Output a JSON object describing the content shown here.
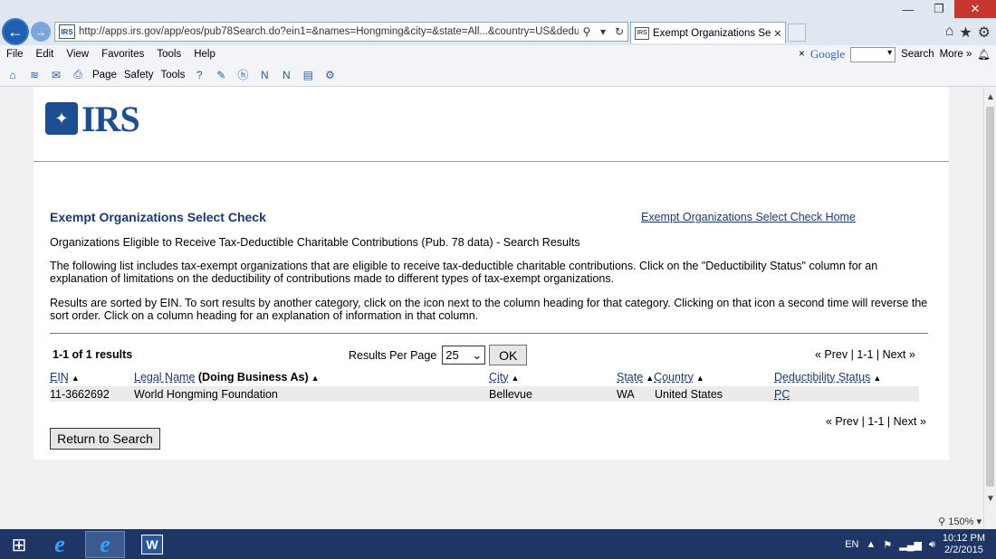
{
  "browser": {
    "url": "http://apps.irs.gov/app/eos/pub78Search.do?ein1=&names=Hongming&city=&state=All...&country=US&deductibility=al",
    "tab_title": "Exempt Organizations Sele...",
    "menu": [
      "File",
      "Edit",
      "View",
      "Favorites",
      "Tools",
      "Help"
    ],
    "commands": {
      "page": "Page",
      "safety": "Safety",
      "tools": "Tools"
    },
    "google_bar": {
      "close": "×",
      "logo": "Google",
      "search": "Search",
      "more": "More »"
    },
    "zoom": "150%",
    "icons": [
      "back-icon",
      "forward-icon",
      "home-icon",
      "star-icon",
      "gear-icon",
      "search-icon",
      "refresh-icon"
    ]
  },
  "page": {
    "logo_text": "IRS",
    "heading": "Exempt Organizations Select Check",
    "home_link": "Exempt Organizations Select Check Home",
    "subtitle": "Organizations Eligible to Receive Tax-Deductible Charitable Contributions (Pub. 78 data) - Search Results",
    "paragraph1": "The following list includes tax-exempt organizations that are eligible to receive tax-deductible charitable contributions. Click on the \"Deductibility Status\" column for an explanation of limitations on the deductibility of contributions made to different types of tax-exempt organizations.",
    "paragraph2": "Results are sorted by EIN. To sort results by another category, click on the icon next to the column heading for that category. Clicking on that icon a second time will reverse the sort order. Click on a column heading for an explanation of information in that column.",
    "results_count": "1-1 of 1 results",
    "results_per_page_label": "Results Per Page",
    "results_per_page_value": "25",
    "ok_label": "OK",
    "pager": {
      "prev": "« Prev",
      "range": "1-1",
      "next": "Next »",
      "sep": "|"
    },
    "columns": {
      "ein": "EIN",
      "legal_name": "Legal Name",
      "dba": "(Doing Business As)",
      "city": "City",
      "state": "State",
      "country": "Country",
      "deductibility": "Deductibility Status"
    },
    "rows": [
      {
        "ein": "11-3662692",
        "legal_name": "World Hongming Foundation",
        "city": "Bellevue",
        "state": "WA",
        "country": "United States",
        "deductibility": "PC"
      }
    ],
    "return_button": "Return to Search"
  },
  "taskbar": {
    "language": "EN",
    "time": "10:12 PM",
    "date": "2/2/2015"
  }
}
